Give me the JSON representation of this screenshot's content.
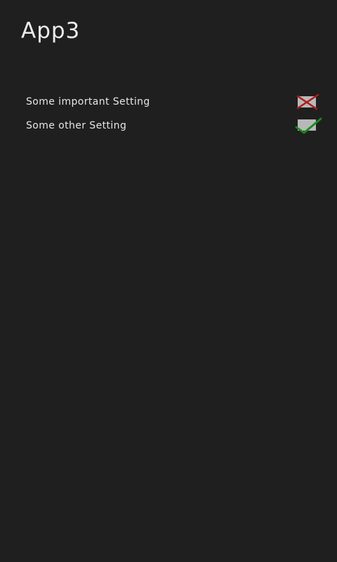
{
  "app": {
    "title": "App3"
  },
  "settings": [
    {
      "label": "Some important Setting",
      "checked": false,
      "icon": "cross-icon",
      "mark_color": "#b01a1a"
    },
    {
      "label": "Some other Setting",
      "checked": true,
      "icon": "check-icon",
      "mark_color": "#1a8a1a"
    }
  ],
  "colors": {
    "background": "#1f1f1f",
    "text": "#e6e6e6",
    "checkbox_fill": "#b8b8b8",
    "unchecked_mark": "#b01a1a",
    "checked_mark": "#1a8a1a"
  }
}
